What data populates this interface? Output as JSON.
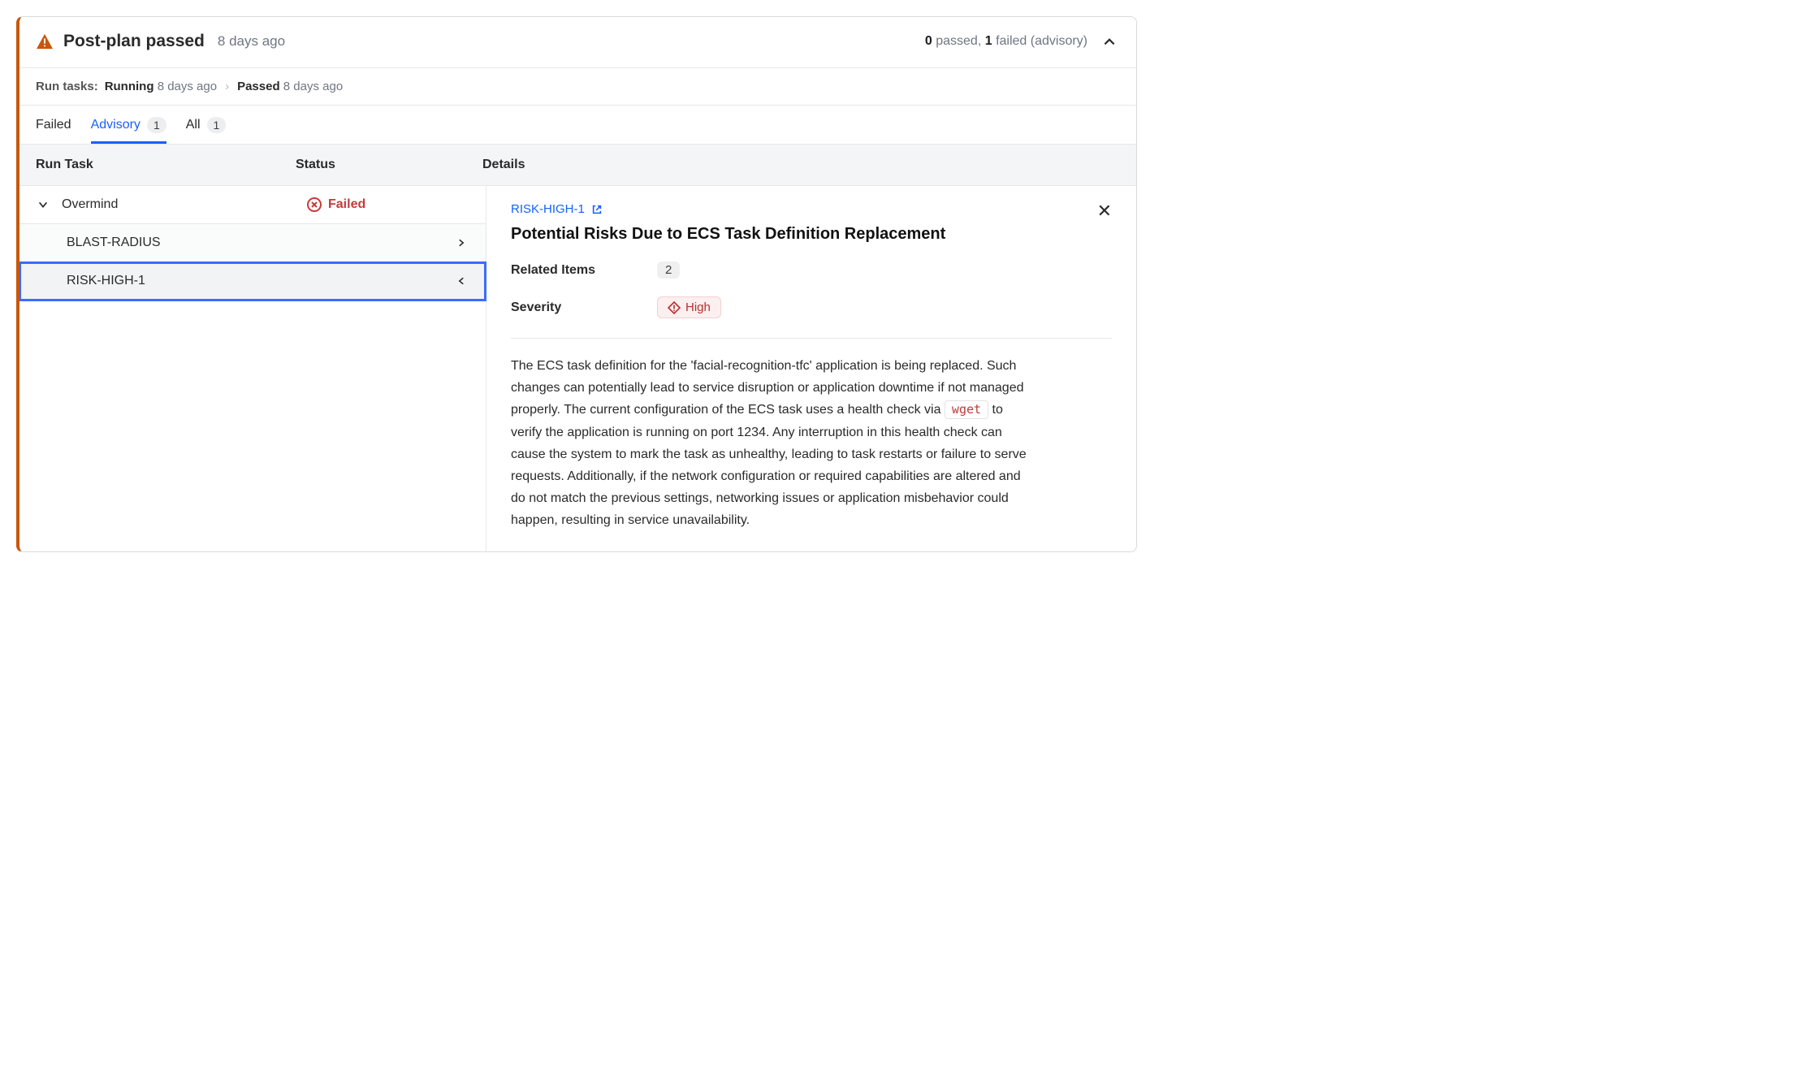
{
  "header": {
    "title": "Post-plan passed",
    "time": "8 days ago",
    "summary_passed": "0",
    "summary_passed_label": " passed, ",
    "summary_failed": "1",
    "summary_failed_label": " failed (advisory)"
  },
  "breadcrumb": {
    "label": "Run tasks:",
    "step1_strong": "Running",
    "step1_time": "8 days ago",
    "step2_strong": "Passed",
    "step2_time": "8 days ago"
  },
  "tabs": {
    "failed": {
      "label": "Failed"
    },
    "advisory": {
      "label": "Advisory",
      "count": "1"
    },
    "all": {
      "label": "All",
      "count": "1"
    }
  },
  "columns": {
    "task": "Run Task",
    "status": "Status",
    "details": "Details"
  },
  "rows": {
    "overmind": {
      "name": "Overmind",
      "status": "Failed"
    },
    "blast": {
      "name": "BLAST-RADIUS"
    },
    "risk": {
      "name": "RISK-HIGH-1"
    }
  },
  "details": {
    "link_label": "RISK-HIGH-1",
    "title": "Potential Risks Due to ECS Task Definition Replacement",
    "related_label": "Related Items",
    "related_count": "2",
    "severity_label": "Severity",
    "severity_value": "High",
    "body_pre": "The ECS task definition for the 'facial-recognition-tfc' application is being replaced. Such changes can potentially lead to service disruption or application downtime if not managed properly. The current configuration of the ECS task uses a health check via ",
    "body_code": "wget",
    "body_post": " to verify the application is running on port 1234. Any interruption in this health check can cause the system to mark the task as unhealthy, leading to task restarts or failure to serve requests. Additionally, if the network configuration or required capabilities are altered and do not match the previous settings, networking issues or application misbehavior could happen, resulting in service unavailability."
  }
}
